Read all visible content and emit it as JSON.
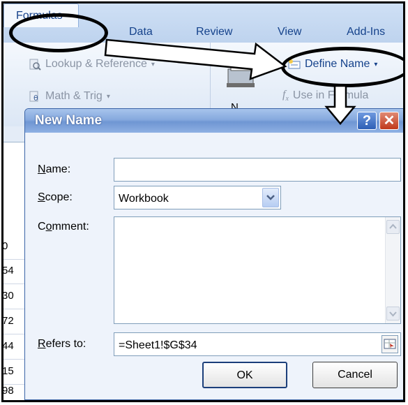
{
  "ribbon": {
    "tabs": [
      "Formulas",
      "Data",
      "Review",
      "View",
      "Add-Ins"
    ],
    "lookup_label": "Lookup & Reference",
    "math_label": "Math & Trig",
    "define_name_label": "Define Name",
    "use_in_formula_label": "Use in Formula",
    "name_manager_partial": "N"
  },
  "sheet": {
    "row_fragments": [
      "54",
      "30",
      "72",
      "44",
      "15",
      "98"
    ],
    "top_fragment": "0"
  },
  "dialog": {
    "title": "New Name",
    "help_glyph": "?",
    "close_glyph": "✕",
    "name_label": "Name:",
    "name_accel": "N",
    "name_rest": "ame:",
    "scope_label": "Scope:",
    "scope_accel": "S",
    "scope_rest": "cope:",
    "scope_value": "Workbook",
    "comment_label": "Comment:",
    "comment_pre": "C",
    "comment_accel": "o",
    "comment_rest": "mment:",
    "refers_label": "Refers to:",
    "refers_accel": "R",
    "refers_rest": "efers to:",
    "refers_value": "=Sheet1!$G$34",
    "name_value": "",
    "comment_value": "",
    "ok_label": "OK",
    "cancel_label": "Cancel"
  },
  "colors": {
    "title_bar": "#7ea3dd",
    "ribbon_text": "#15428b",
    "annotation": "#000000"
  }
}
